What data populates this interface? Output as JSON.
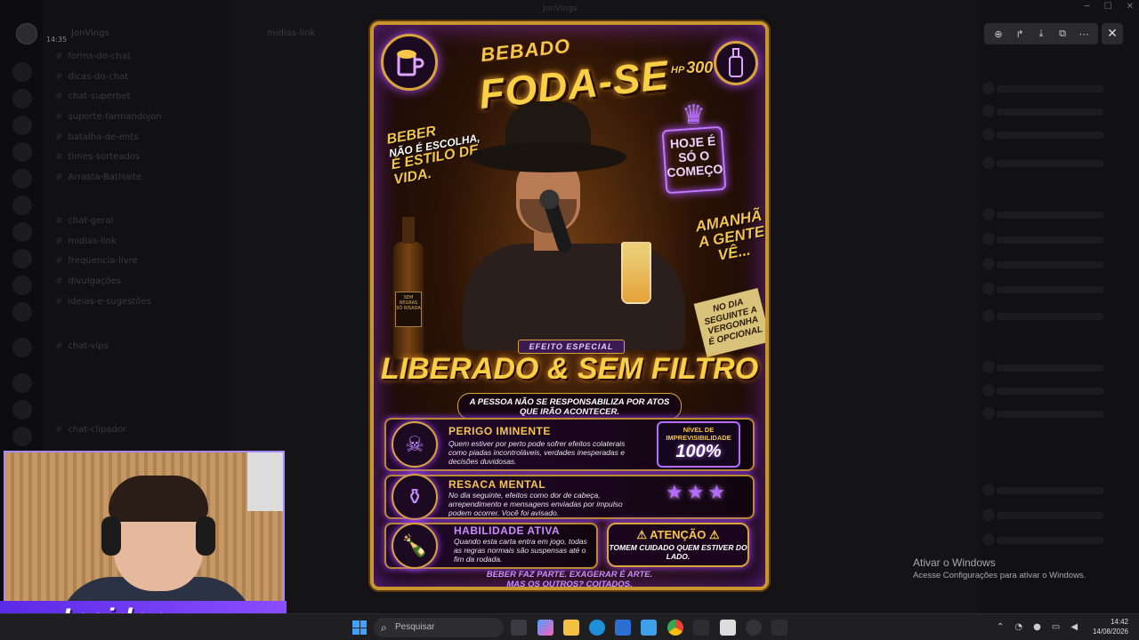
{
  "window": {
    "title": "JonVings"
  },
  "sidebar": {
    "server_name": "JonVings",
    "time": "14:35",
    "channels": [
      "forms-do-chat",
      "dicas-do-chat",
      "chat-superbet",
      "suporte-farmandojon",
      "batalha-de-ents",
      "times-sorteados",
      "Arrasta-BatHalte",
      "chat-geral",
      "midias-link",
      "frequencia-livre",
      "divulgações",
      "ideias-e-sugestões",
      "chat-vips",
      "chat-clipador"
    ]
  },
  "chat_header": {
    "channel": "midias-link"
  },
  "viewer": {
    "icons": [
      "zoom-icon",
      "share-icon",
      "download-icon",
      "open-external-icon",
      "more-icon"
    ],
    "close_icon": "close-icon"
  },
  "card": {
    "title_top": "BEBADO",
    "title_main": "FODA-SE",
    "hp_label": "HP",
    "hp_value": "300",
    "left_slogan_1": "BEBER",
    "left_slogan_2": "NÃO É ESCOLHA,",
    "left_slogan_3": "É ESTILO DE VIDA.",
    "neon_sign": "HOJE É SÓ O COMEÇO",
    "right_slogan": "AMANHÃ A GENTE VÊ...",
    "paper_note": "NO DIA SEGUINTE A VERGONHA É OPCIONAL",
    "bottle_label": "SEM REGRAS SÓ RISADA",
    "effect_label": "EFEITO ESPECIAL",
    "ability_title": "LIBERADO & SEM FILTRO",
    "ability_sub_1": "A PESSOA NÃO SE RESPONSABILIZA POR ATOS",
    "ability_sub_2": "QUE IRÃO ACONTECER.",
    "row1_title": "PERIGO IMINENTE",
    "row1_text": "Quem estiver por perto pode sofrer efeitos colaterais como piadas incontroláveis, verdades inesperadas e decisões duvidosas.",
    "level_label": "NÍVEL DE IMPREVISIBILIDADE",
    "level_value": "100%",
    "row2_title": "RESACA MENTAL",
    "row2_text": "No dia seguinte, efeitos como dor de cabeça, arrependimento e mensagens enviadas por impulso podem ocorrer. Você foi avisado.",
    "stars": "★★★",
    "row3_title": "HABILIDADE ATIVA",
    "row3_text": "Quando esta carta entra em jogo, todas as regras normais são suspensas até o fim da rodada.",
    "attention_title": "⚠ ATENÇÃO ⚠",
    "attention_text": "TOMEM CUIDADO QUEM ESTIVER DO LADO.",
    "footer_1": "BEBER FAZ PARTE. EXAGERAR É ARTE.",
    "footer_2": "MAS OS OUTROS? COITADOS."
  },
  "overlay": {
    "brand": "Insider"
  },
  "activation": {
    "title": "Ativar o Windows",
    "subtitle": "Acesse Configurações para ativar o Windows."
  },
  "taskbar": {
    "search_placeholder": "Pesquisar",
    "time": "14:42",
    "date": "14/08/2026"
  },
  "colors": {
    "gold": "#f5c64a",
    "neon_purple": "#b56bff",
    "taskbar": "#1f1f22"
  }
}
